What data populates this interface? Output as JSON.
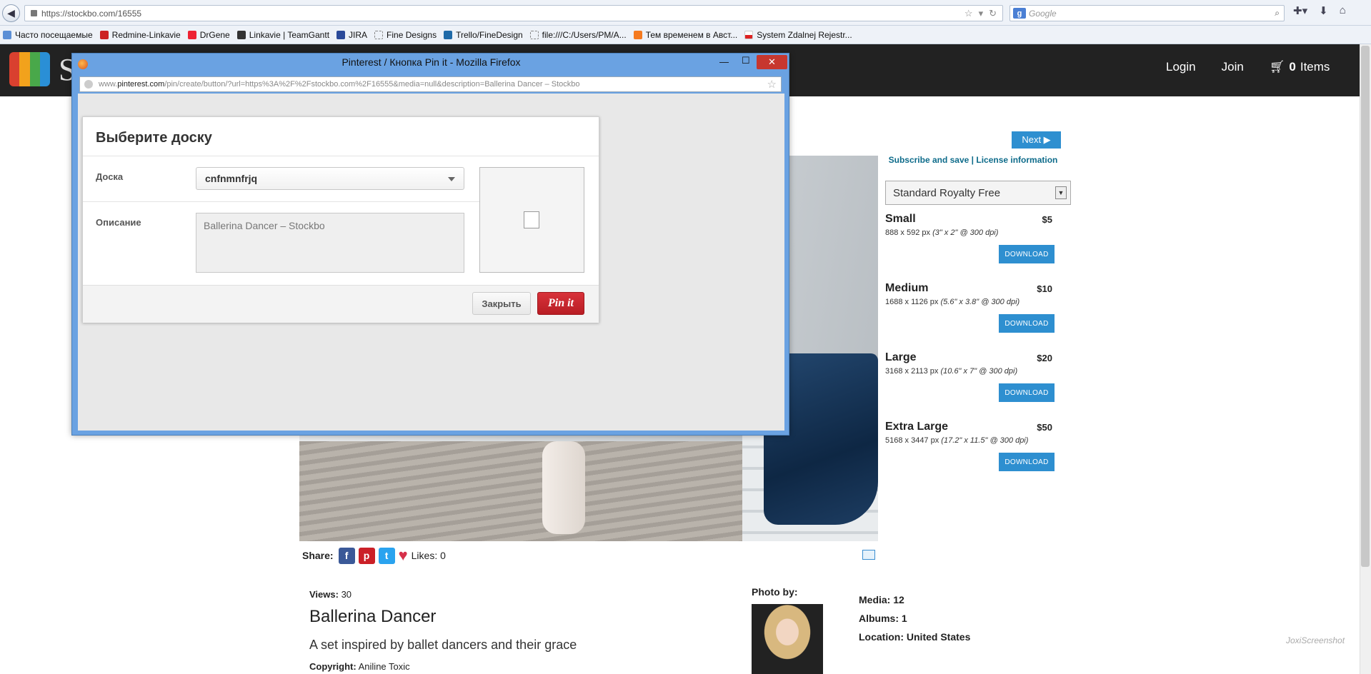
{
  "browser": {
    "url": "https://stockbo.com/16555",
    "search_placeholder": "Google",
    "bookmarks": [
      "Часто посещаемые",
      "Redmine-Linkavie",
      "DrGene",
      "Linkavie | TeamGantt",
      "JIRA",
      "Fine Designs",
      "Trello/FineDesign",
      "file:///C:/Users/PM/A...",
      "Тем временем в Авст...",
      "System Zdalnej Rejestr..."
    ]
  },
  "site": {
    "logo_letter": "S",
    "nav": {
      "login": "Login",
      "join": "Join",
      "cart_count": "0",
      "cart_label": "Items"
    },
    "next_label": "Next ▶",
    "subscribe": "Subscribe and save",
    "license_info": "License information",
    "license_select": "Standard Royalty Free",
    "sizes": [
      {
        "name": "Small",
        "price": "$5",
        "px": "888 x 592 px",
        "inch": "(3\" x 2\" @ 300 dpi)",
        "download": "DOWNLOAD"
      },
      {
        "name": "Medium",
        "price": "$10",
        "px": "1688 x 1126 px",
        "inch": "(5.6\" x 3.8\" @ 300 dpi)",
        "download": "DOWNLOAD"
      },
      {
        "name": "Large",
        "price": "$20",
        "px": "3168 x 2113 px",
        "inch": "(10.6\" x 7\" @ 300 dpi)",
        "download": "DOWNLOAD"
      },
      {
        "name": "Extra Large",
        "price": "$50",
        "px": "5168 x 3447 px",
        "inch": "(17.2\" x 11.5\" @ 300 dpi)",
        "download": "DOWNLOAD"
      }
    ],
    "share_label": "Share:",
    "likes": "Likes: 0",
    "views_label": "Views:",
    "views_value": "30",
    "title": "Ballerina Dancer",
    "description": "A set inspired by ballet dancers and their grace",
    "copyright_label": "Copyright:",
    "copyright_value": "Aniline Toxic",
    "photo_by": "Photo by:",
    "stats": [
      {
        "label": "Media:",
        "value": "12"
      },
      {
        "label": "Albums:",
        "value": "1"
      },
      {
        "label": "Location:",
        "value": "United States"
      }
    ],
    "watermark": "JoxiScreenshot"
  },
  "popup": {
    "window_title": "Pinterest / Кнопка Pin it - Mozilla Firefox",
    "url_prefix": "www.",
    "url_domain": "pinterest.com",
    "url_rest": "/pin/create/button/?url=https%3A%2F%2Fstockbo.com%2F16555&media=null&description=Ballerina Dancer – Stockbo",
    "dialog_title": "Выберите доску",
    "board_label": "Доска",
    "board_value": "cnfnmnfrjq",
    "desc_label": "Описание",
    "desc_value": "Ballerina Dancer – Stockbo",
    "close_label": "Закрыть",
    "pin_label": "Pin it"
  }
}
